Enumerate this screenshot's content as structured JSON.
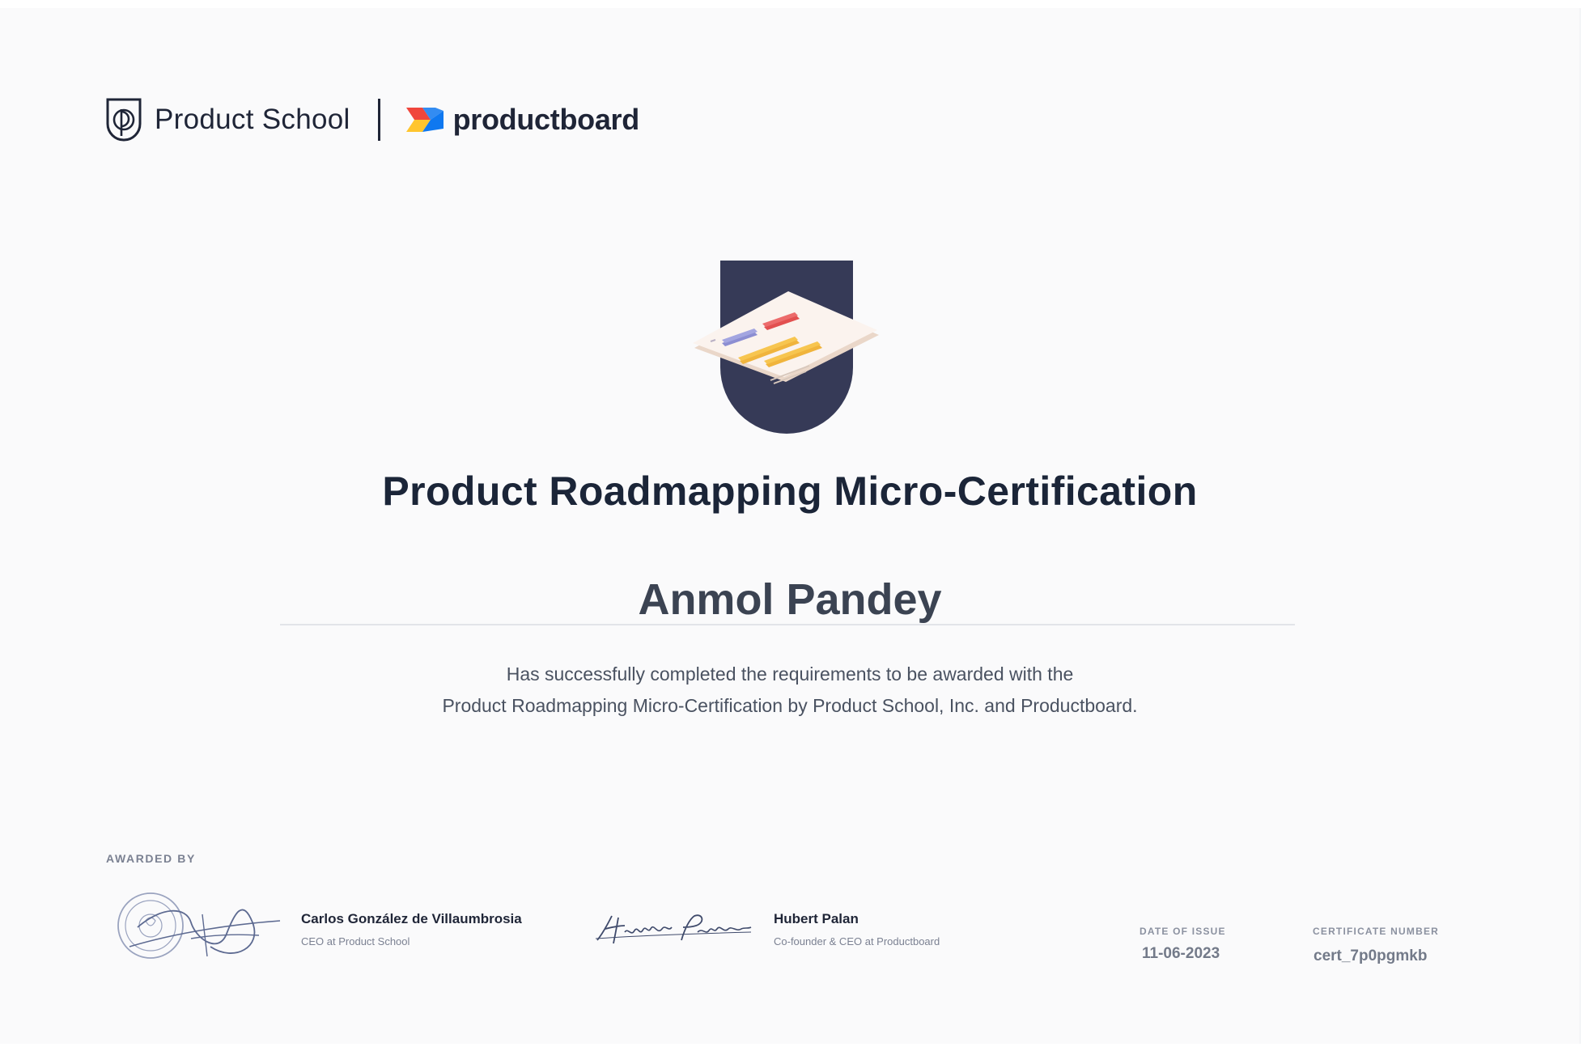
{
  "logos": {
    "product_school": "Product School",
    "productboard": "productboard"
  },
  "certificate": {
    "title": "Product Roadmapping Micro-Certification",
    "recipient": "Anmol Pandey",
    "description_line1": "Has successfully completed the requirements to be awarded with the",
    "description_line2": "Product Roadmapping Micro-Certification by Product School, Inc. and Productboard."
  },
  "awarded_by": {
    "label": "AWARDED BY",
    "signers": [
      {
        "name": "Carlos González de Villaumbrosia",
        "role": "CEO at Product School"
      },
      {
        "name": "Hubert Palan",
        "role": "Co-founder & CEO at Productboard"
      }
    ]
  },
  "meta": {
    "date_label": "DATE OF ISSUE",
    "date_value": "11-06-2023",
    "cert_label": "CERTIFICATE NUMBER",
    "cert_value": "cert_7p0pgmkb"
  },
  "colors": {
    "navy": "#1f2537",
    "badge_navy": "#363a57",
    "accent_red": "#ec5d5d",
    "accent_yellow": "#f7c54f",
    "accent_purple": "#8c8ed2",
    "productboard_red": "#f0463c",
    "productboard_yellow": "#ffc52e",
    "productboard_blue": "#0f78f0"
  },
  "icons": {
    "product_school": "product-school-shield-icon",
    "productboard": "productboard-mark-icon",
    "badge": "roadmap-badge-icon",
    "seal": "signature-seal-icon"
  }
}
